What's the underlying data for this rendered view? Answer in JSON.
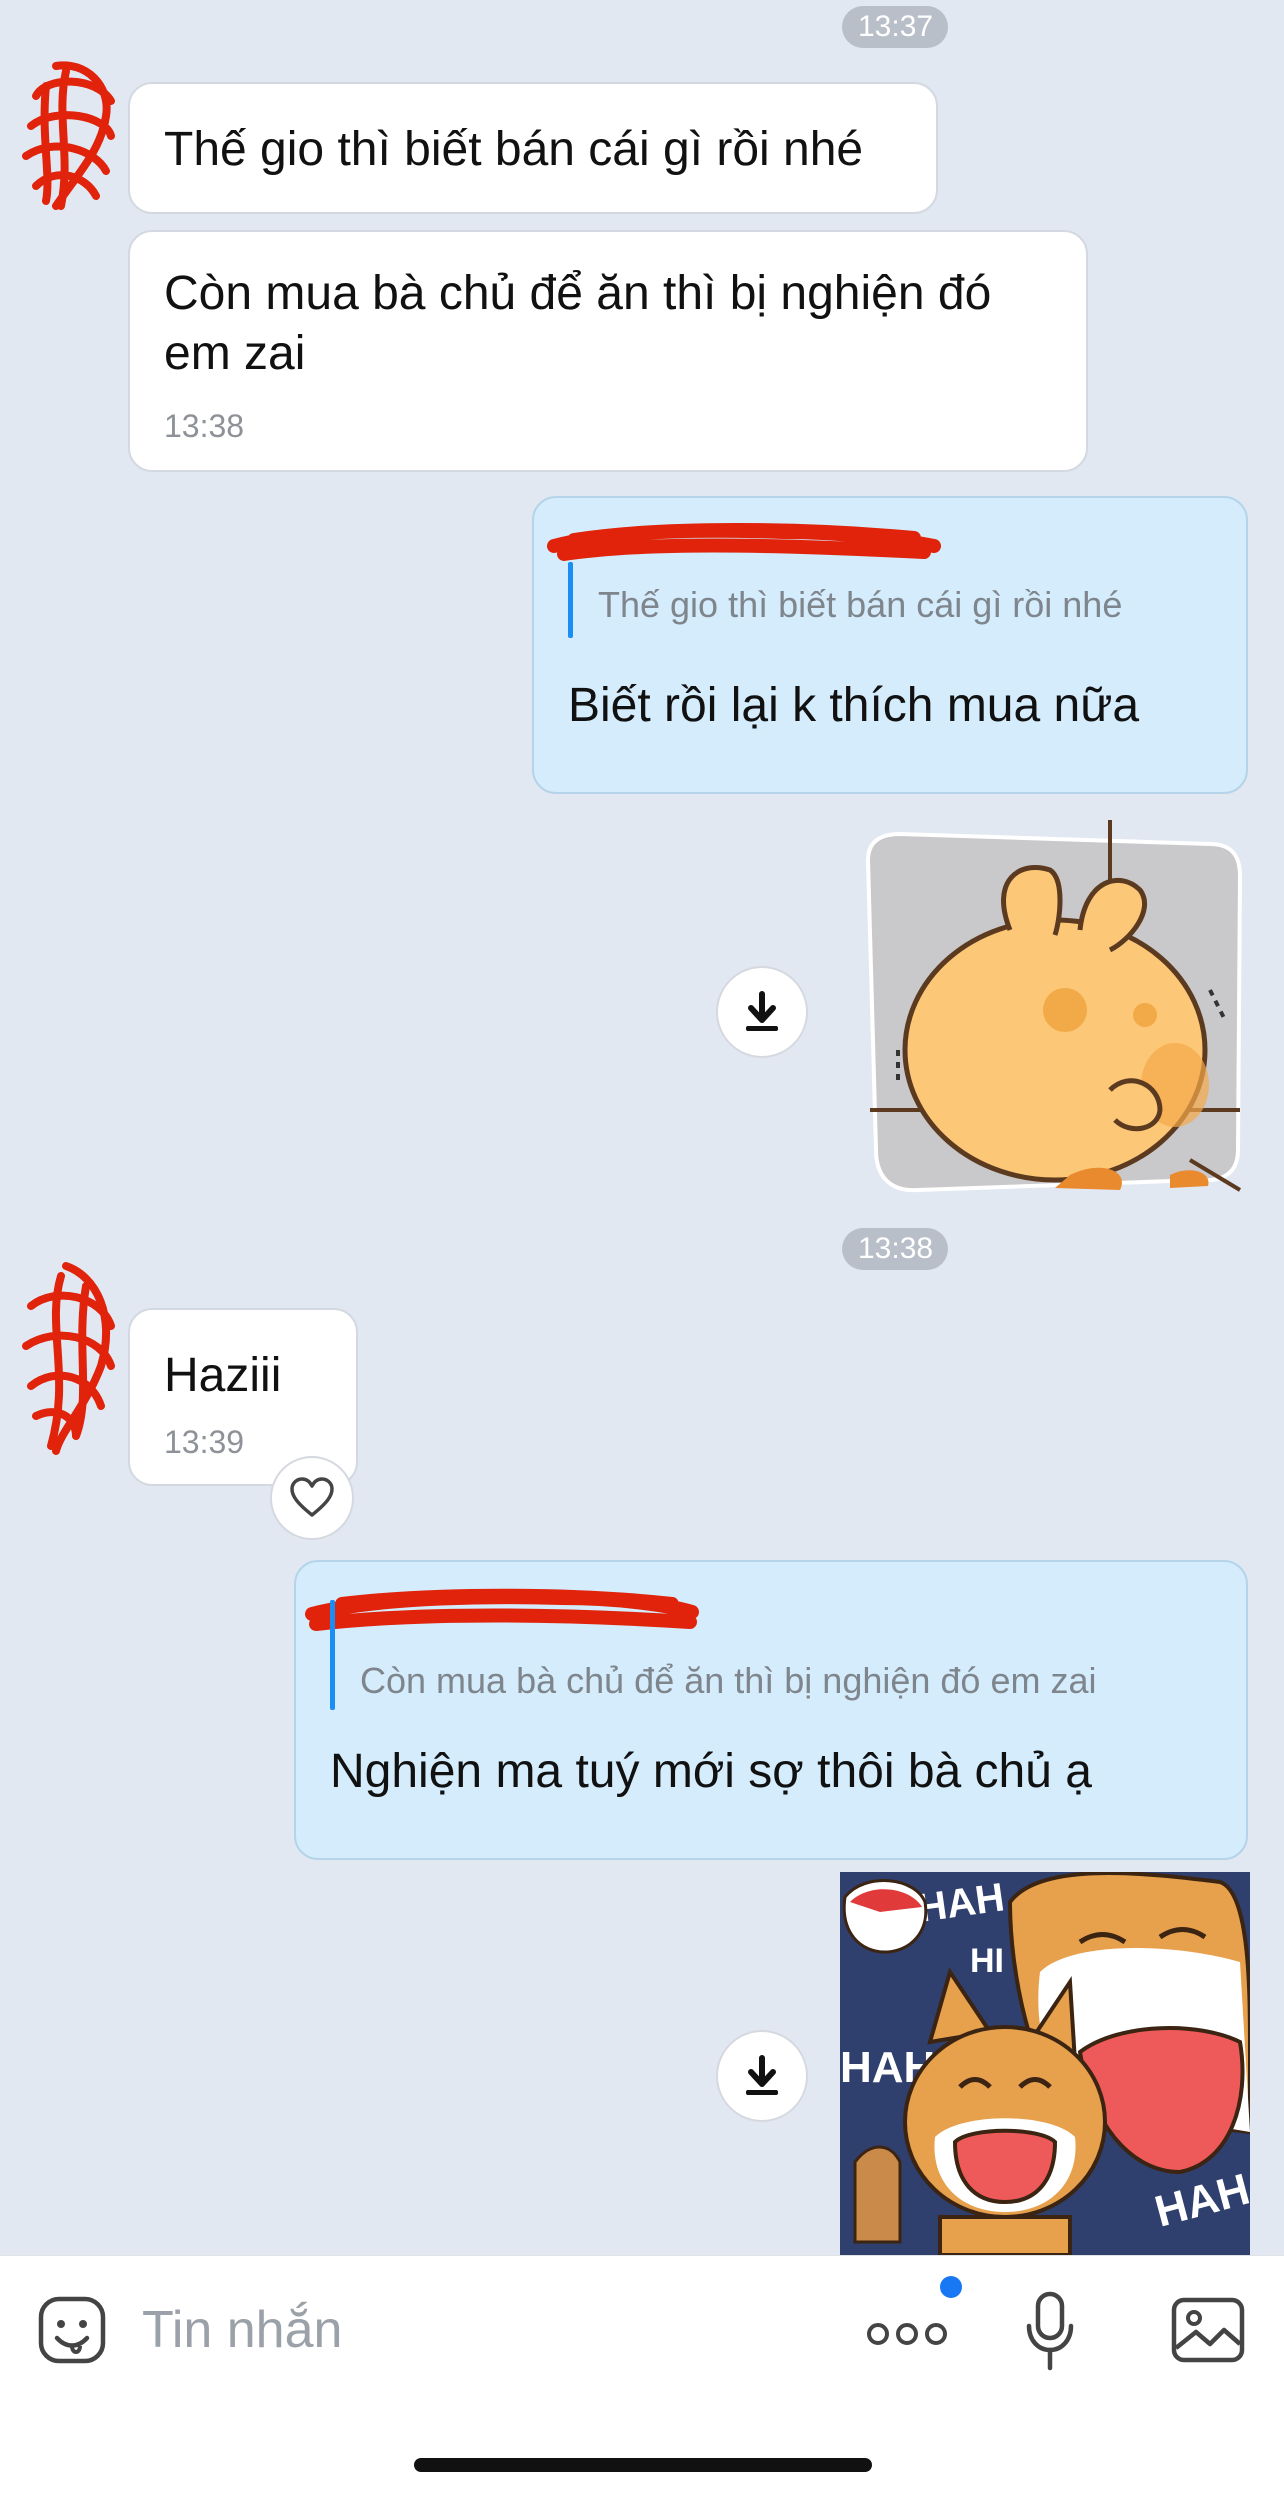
{
  "timestamps": {
    "top": "13:37",
    "middle": "13:38"
  },
  "messages": [
    {
      "id": "m1",
      "direction": "incoming",
      "text": "Thế gio thì biết bán cái gì rồi nhé"
    },
    {
      "id": "m2",
      "direction": "incoming",
      "text_line1": "Còn mua bà chủ để ăn thì bị nghiện đó",
      "text_line2": "em zai",
      "time": "13:38"
    },
    {
      "id": "m3",
      "direction": "outgoing",
      "quote": "Thế gio thì biết bán cái gì rồi nhé",
      "text": "Biết rồi lại k thích mua nữa"
    },
    {
      "id": "m4",
      "direction": "outgoing",
      "type": "sticker",
      "icon": "download-icon"
    },
    {
      "id": "m5",
      "direction": "incoming",
      "text": "Haziii",
      "time": "13:39",
      "reaction_icon": "heart-icon"
    },
    {
      "id": "m6",
      "direction": "outgoing",
      "quote": "Còn mua bà chủ để ăn thì bị nghiện đó em zai",
      "text": "Nghiện ma tuý mới sợ thôi bà chủ ạ"
    },
    {
      "id": "m7",
      "direction": "outgoing",
      "type": "sticker",
      "icon": "download-icon",
      "sticker_words": [
        "HAH",
        "HI",
        "HAHA",
        "HAH"
      ]
    }
  ],
  "composer": {
    "placeholder": "Tin nhắn",
    "icons": [
      "emoji-icon",
      "more-icon",
      "microphone-icon",
      "image-icon"
    ],
    "more_badge_color": "#1877f2"
  },
  "colors": {
    "background": "#e2e8f2",
    "outgoing_bubble": "#d4ecfb",
    "incoming_bubble": "#ffffff",
    "quote_bar": "#1b8ef5",
    "redaction": "#e0230a"
  }
}
